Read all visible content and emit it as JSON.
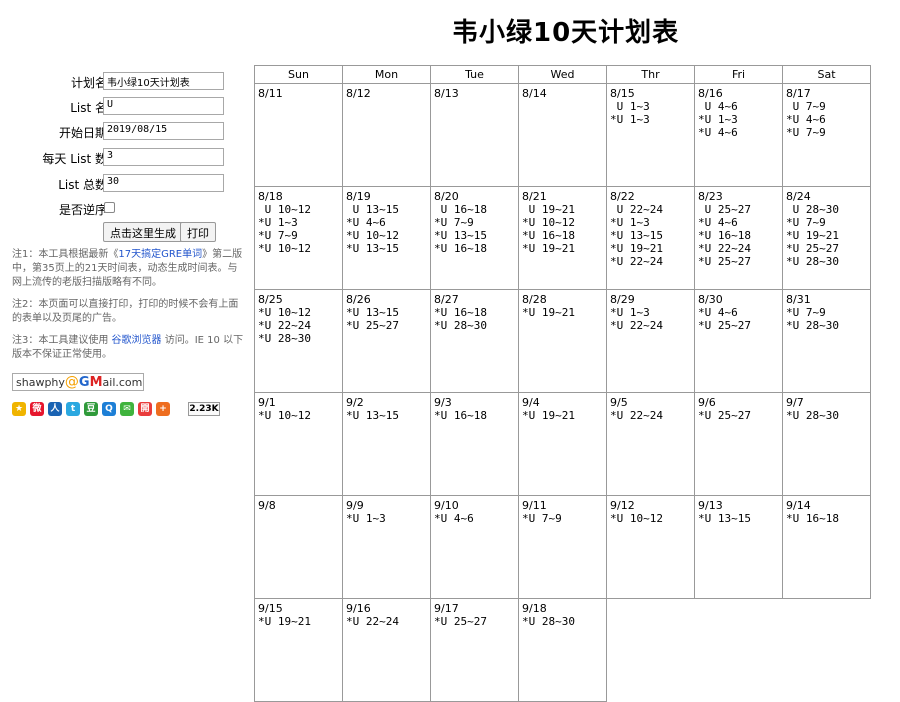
{
  "page_title": "韦小绿10天计划表",
  "form": {
    "plan_name_label": "计划名",
    "plan_name_value": "韦小绿10天计划表",
    "list_name_label": "List 名",
    "list_name_value": "U",
    "start_date_label": "开始日期",
    "start_date_value": "2019/08/15",
    "per_day_label": "每天 List 数",
    "per_day_value": "3",
    "total_label": "List 总数",
    "total_value": "30",
    "reverse_label": "是否逆序",
    "generate_button": "点击这里生成",
    "print_button": "打印"
  },
  "notes": {
    "note1_pre": "注1：本工具根据最新《",
    "note1_link": "17天搞定GRE单词",
    "note1_post": "》第二版中，第35页上的21天时间表，动态生成时间表。与网上流传的老版扫描版略有不同。",
    "note2": "注2：本页面可以直接打印，打印的时候不会有上面的表单以及页尾的广告。",
    "note3_pre": "注3：本工具建议使用 ",
    "note3_link": "谷歌浏览器",
    "note3_post": " 访问。IE 10 以下版本不保证正常使用。"
  },
  "email": {
    "user": "shawphy",
    "at": "@",
    "g": "G",
    "m": "M",
    "rest": "ail.com"
  },
  "share": {
    "icons": [
      "qzone-icon",
      "weibo-icon",
      "renren-icon",
      "tencent-weibo-icon",
      "douban-icon",
      "qq-icon",
      "wechat-icon",
      "kaixin-icon",
      "more-icon"
    ],
    "count": "2.23K"
  },
  "calendar": {
    "weekdays": [
      "Sun",
      "Mon",
      "Tue",
      "Wed",
      "Thr",
      "Fri",
      "Sat"
    ],
    "weeks": [
      [
        {
          "date": "8/11",
          "lines": []
        },
        {
          "date": "8/12",
          "lines": []
        },
        {
          "date": "8/13",
          "lines": []
        },
        {
          "date": "8/14",
          "lines": []
        },
        {
          "date": "8/15",
          "lines": [
            " U 1~3",
            "*U 1~3"
          ]
        },
        {
          "date": "8/16",
          "lines": [
            " U 4~6",
            "*U 1~3",
            "*U 4~6"
          ]
        },
        {
          "date": "8/17",
          "lines": [
            " U 7~9",
            "*U 4~6",
            "*U 7~9"
          ]
        }
      ],
      [
        {
          "date": "8/18",
          "lines": [
            " U 10~12",
            "*U 1~3",
            "*U 7~9",
            "*U 10~12"
          ]
        },
        {
          "date": "8/19",
          "lines": [
            " U 13~15",
            "*U 4~6",
            "*U 10~12",
            "*U 13~15"
          ]
        },
        {
          "date": "8/20",
          "lines": [
            " U 16~18",
            "*U 7~9",
            "*U 13~15",
            "*U 16~18"
          ]
        },
        {
          "date": "8/21",
          "lines": [
            " U 19~21",
            "*U 10~12",
            "*U 16~18",
            "*U 19~21"
          ]
        },
        {
          "date": "8/22",
          "lines": [
            " U 22~24",
            "*U 1~3",
            "*U 13~15",
            "*U 19~21",
            "*U 22~24"
          ]
        },
        {
          "date": "8/23",
          "lines": [
            " U 25~27",
            "*U 4~6",
            "*U 16~18",
            "*U 22~24",
            "*U 25~27"
          ]
        },
        {
          "date": "8/24",
          "lines": [
            " U 28~30",
            "*U 7~9",
            "*U 19~21",
            "*U 25~27",
            "*U 28~30"
          ]
        }
      ],
      [
        {
          "date": "8/25",
          "lines": [
            "*U 10~12",
            "*U 22~24",
            "*U 28~30"
          ]
        },
        {
          "date": "8/26",
          "lines": [
            "*U 13~15",
            "*U 25~27"
          ]
        },
        {
          "date": "8/27",
          "lines": [
            "*U 16~18",
            "*U 28~30"
          ]
        },
        {
          "date": "8/28",
          "lines": [
            "*U 19~21"
          ]
        },
        {
          "date": "8/29",
          "lines": [
            "*U 1~3",
            "*U 22~24"
          ]
        },
        {
          "date": "8/30",
          "lines": [
            "*U 4~6",
            "*U 25~27"
          ]
        },
        {
          "date": "8/31",
          "lines": [
            "*U 7~9",
            "*U 28~30"
          ]
        }
      ],
      [
        {
          "date": "9/1",
          "lines": [
            "*U 10~12"
          ]
        },
        {
          "date": "9/2",
          "lines": [
            "*U 13~15"
          ]
        },
        {
          "date": "9/3",
          "lines": [
            "*U 16~18"
          ]
        },
        {
          "date": "9/4",
          "lines": [
            "*U 19~21"
          ]
        },
        {
          "date": "9/5",
          "lines": [
            "*U 22~24"
          ]
        },
        {
          "date": "9/6",
          "lines": [
            "*U 25~27"
          ]
        },
        {
          "date": "9/7",
          "lines": [
            "*U 28~30"
          ]
        }
      ],
      [
        {
          "date": "9/8",
          "lines": []
        },
        {
          "date": "9/9",
          "lines": [
            "*U 1~3"
          ]
        },
        {
          "date": "9/10",
          "lines": [
            "*U 4~6"
          ]
        },
        {
          "date": "9/11",
          "lines": [
            "*U 7~9"
          ]
        },
        {
          "date": "9/12",
          "lines": [
            "*U 10~12"
          ]
        },
        {
          "date": "9/13",
          "lines": [
            "*U 13~15"
          ]
        },
        {
          "date": "9/14",
          "lines": [
            "*U 16~18"
          ]
        }
      ],
      [
        {
          "date": "9/15",
          "lines": [
            "*U 19~21"
          ]
        },
        {
          "date": "9/16",
          "lines": [
            "*U 22~24"
          ]
        },
        {
          "date": "9/17",
          "lines": [
            "*U 25~27"
          ]
        },
        {
          "date": "9/18",
          "lines": [
            "*U 28~30"
          ]
        },
        null,
        null,
        null
      ]
    ]
  }
}
